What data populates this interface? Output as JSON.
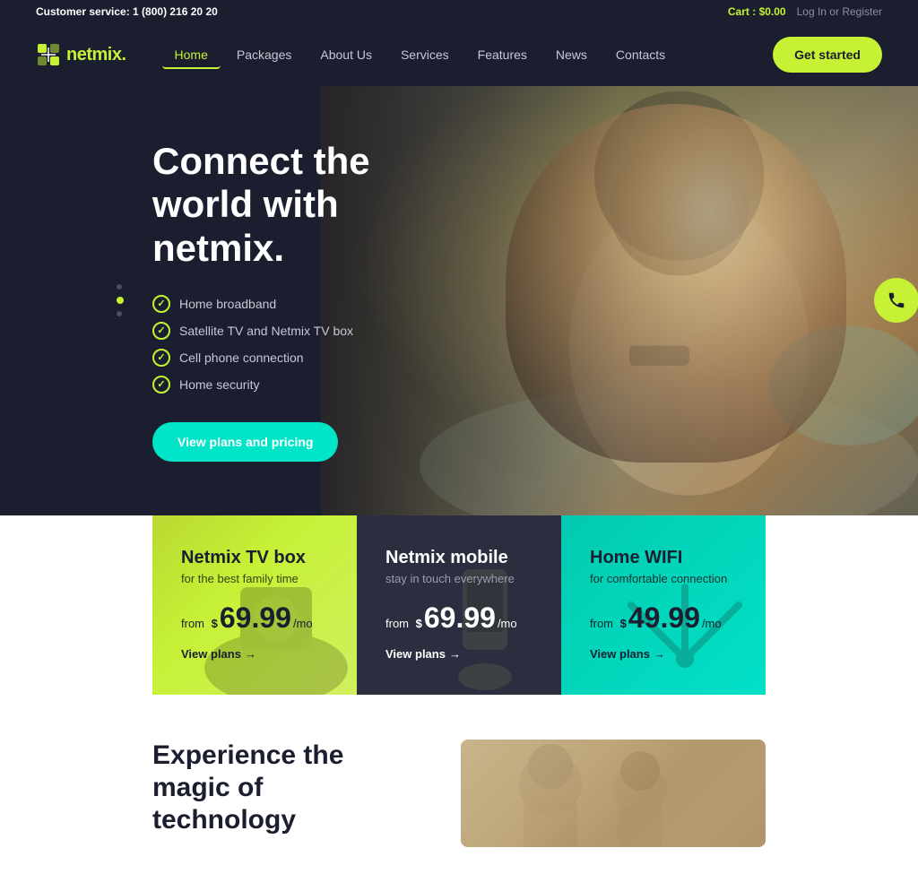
{
  "topbar": {
    "customer_service_label": "Customer service: ",
    "phone": "1 (800) 216 20 20",
    "cart_label": "Cart : ",
    "cart_amount": "$0.00",
    "login_label": "Log In",
    "or_label": " or ",
    "register_label": "Register"
  },
  "navbar": {
    "logo_text": "netmix",
    "logo_dot": ".",
    "nav_items": [
      {
        "label": "Home",
        "active": true
      },
      {
        "label": "Packages",
        "active": false
      },
      {
        "label": "About Us",
        "active": false
      },
      {
        "label": "Services",
        "active": false
      },
      {
        "label": "Features",
        "active": false
      },
      {
        "label": "News",
        "active": false
      },
      {
        "label": "Contacts",
        "active": false
      }
    ],
    "cta_button": "Get started"
  },
  "hero": {
    "title": "Connect the world with netmix.",
    "features": [
      "Home broadband",
      "Satellite TV and Netmix TV box",
      "Cell phone connection",
      "Home security"
    ],
    "cta_button": "View plans and pricing"
  },
  "cards": [
    {
      "title": "Netmix TV box",
      "subtitle": "for the best family time",
      "price_from": "from",
      "price_dollar": "$",
      "price_amount": "69.99",
      "price_mo": "/mo",
      "link_text": "View plans",
      "type": "yellow"
    },
    {
      "title": "Netmix mobile",
      "subtitle": "stay in touch everywhere",
      "price_from": "from",
      "price_dollar": "$",
      "price_amount": "69.99",
      "price_mo": "/mo",
      "link_text": "View plans",
      "type": "dark"
    },
    {
      "title": "Home WIFI",
      "subtitle": "for comfortable connection",
      "price_from": "from",
      "price_dollar": "$",
      "price_amount": "49.99",
      "price_mo": "/mo",
      "link_text": "View plans",
      "type": "teal"
    }
  ],
  "bottom": {
    "title_line1": "Experience the magic of",
    "title_line2": "technology"
  }
}
